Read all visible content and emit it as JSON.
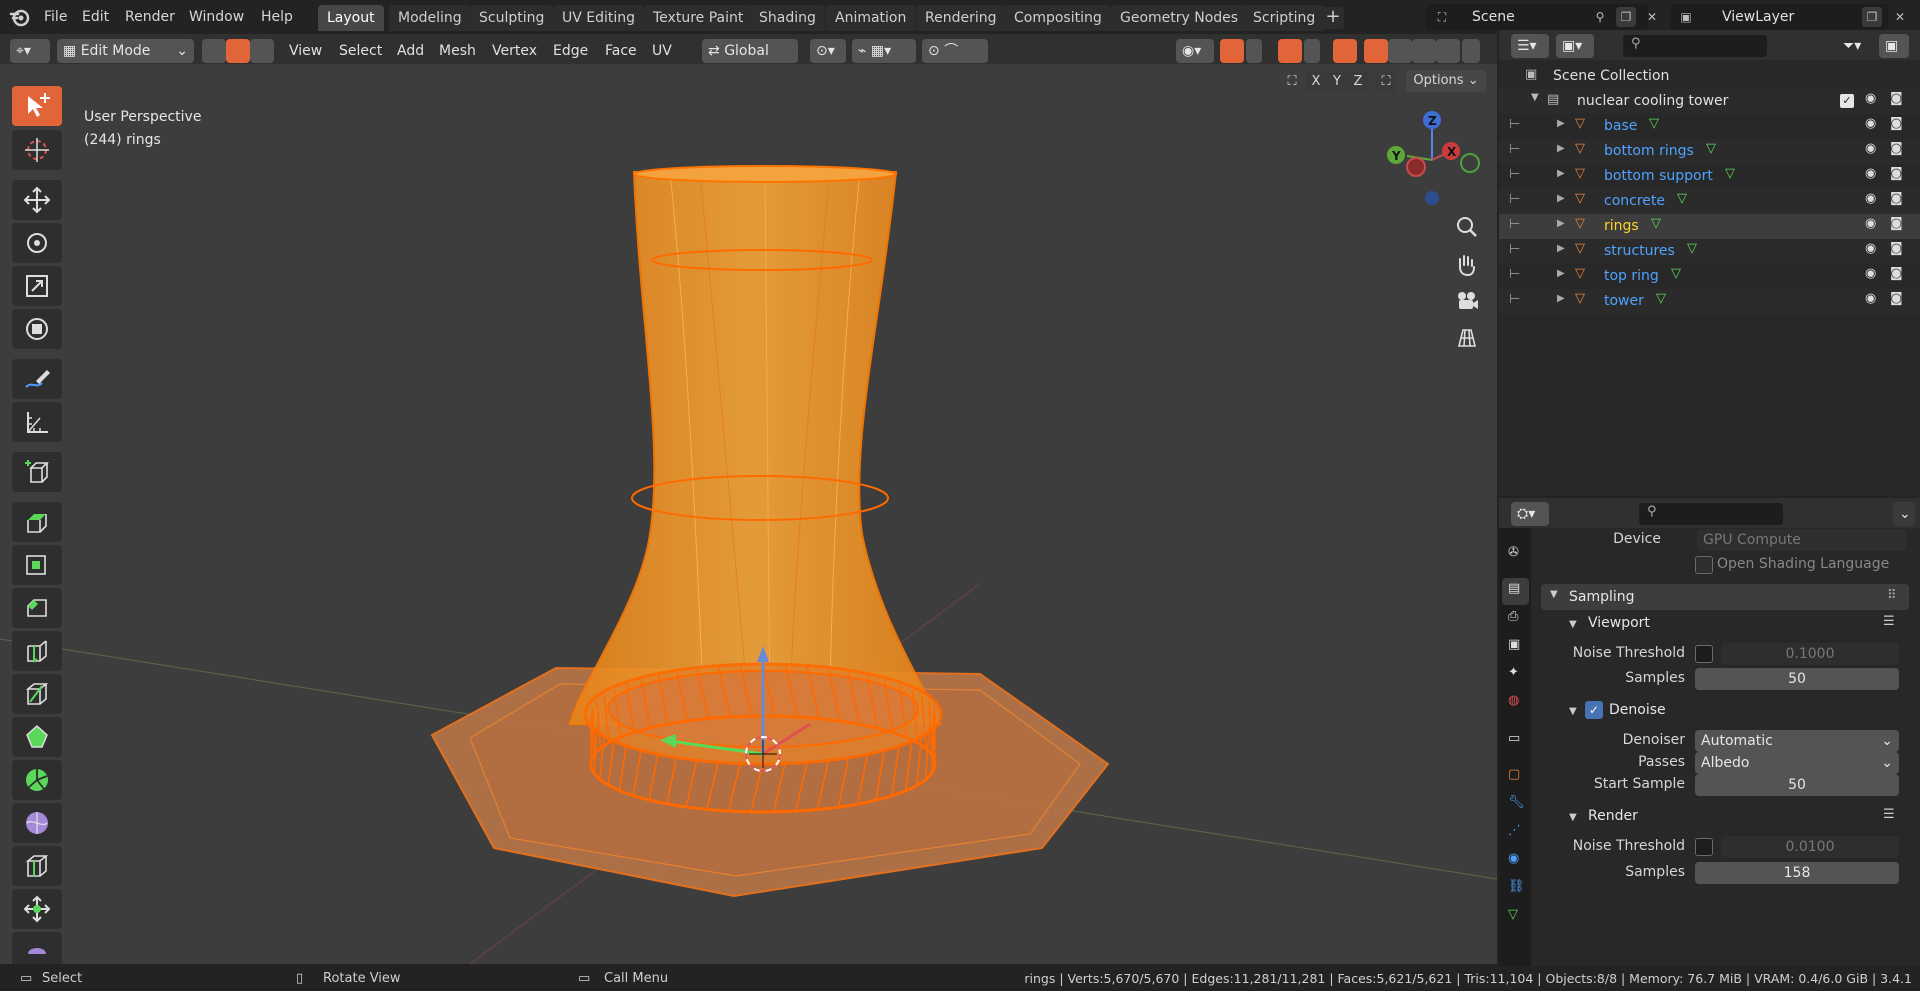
{
  "menus": [
    "File",
    "Edit",
    "Render",
    "Window",
    "Help"
  ],
  "workspaces": [
    "Layout",
    "Modeling",
    "Sculpting",
    "UV Editing",
    "Texture Paint",
    "Shading",
    "Animation",
    "Rendering",
    "Compositing",
    "Geometry Nodes",
    "Scripting"
  ],
  "scene": {
    "scene_name": "Scene",
    "view_layer": "ViewLayer"
  },
  "header": {
    "mode": "Edit Mode",
    "menus": [
      "View",
      "Select",
      "Add",
      "Mesh",
      "Vertex",
      "Edge",
      "Face",
      "UV"
    ],
    "orientation": "Global",
    "options": "Options",
    "axes": [
      "X",
      "Y",
      "Z"
    ]
  },
  "viewport": {
    "perspective": "User Perspective",
    "object_info": "(244) rings",
    "gizmo": {
      "x": "X",
      "y": "Y",
      "z": "Z"
    }
  },
  "outliner": {
    "root": "Scene Collection",
    "collection": "nuclear cooling tower",
    "objects": [
      {
        "name": "base",
        "selected": false
      },
      {
        "name": "bottom rings",
        "selected": false
      },
      {
        "name": "bottom support",
        "selected": false
      },
      {
        "name": "concrete",
        "selected": false
      },
      {
        "name": "rings",
        "selected": true
      },
      {
        "name": "structures",
        "selected": false
      },
      {
        "name": "top ring",
        "selected": false
      },
      {
        "name": "tower",
        "selected": false
      }
    ]
  },
  "properties": {
    "device_label": "Device",
    "device_value": "GPU Compute",
    "osl_label": "Open Shading Language",
    "sampling": "Sampling",
    "viewport": {
      "title": "Viewport",
      "noise_label": "Noise Threshold",
      "noise_value": "0.1000",
      "samples_label": "Samples",
      "samples_value": "50"
    },
    "denoise": {
      "title": "Denoise",
      "denoiser_label": "Denoiser",
      "denoiser_value": "Automatic",
      "passes_label": "Passes",
      "passes_value": "Albedo",
      "start_label": "Start Sample",
      "start_value": "50"
    },
    "render": {
      "title": "Render",
      "noise_label": "Noise Threshold",
      "noise_value": "0.0100",
      "samples_label": "Samples",
      "samples_value": "158"
    }
  },
  "statusbar": {
    "select": "Select",
    "rotate": "Rotate View",
    "call_menu": "Call Menu",
    "stats": "rings | Verts:5,670/5,670 | Edges:11,281/11,281 | Faces:5,621/5,621 | Tris:11,104 | Objects:8/8 | Memory: 76.7 MiB | VRAM: 0.4/6.0 GiB | 3.4.1"
  },
  "colors": {
    "accent": "#4772b3",
    "active_tool": "#e2653a",
    "selection": "#ff8a00",
    "outliner_text": "#4fa3ff",
    "active_object": "#ffd426"
  }
}
